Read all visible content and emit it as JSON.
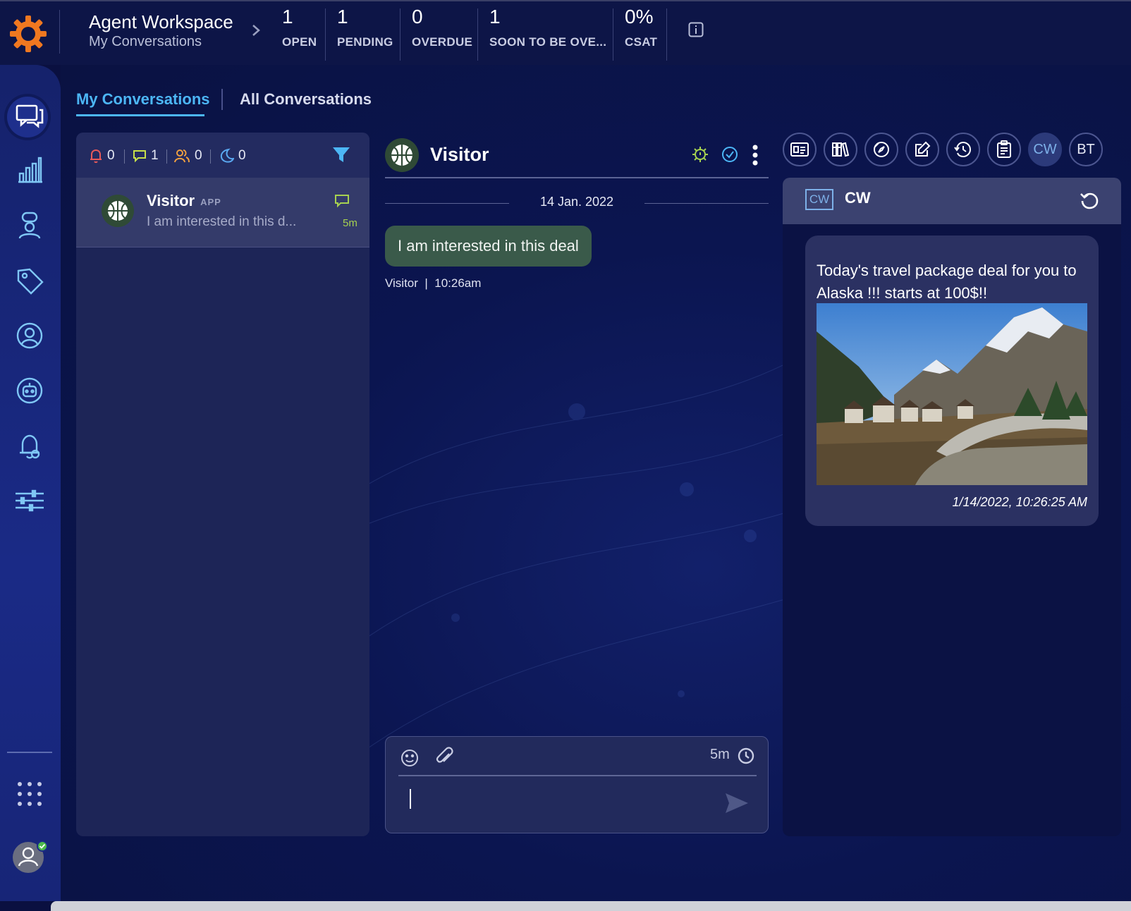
{
  "app": {
    "title": "Agent Workspace",
    "subtitle": "My Conversations"
  },
  "stats": [
    {
      "value": "1",
      "label": "OPEN"
    },
    {
      "value": "1",
      "label": "PENDING"
    },
    {
      "value": "0",
      "label": "OVERDUE"
    },
    {
      "value": "1",
      "label": "SOON TO BE OVE..."
    },
    {
      "value": "0%",
      "label": "CSAT"
    }
  ],
  "tabs": {
    "my": "My Conversations",
    "all": "All Conversations"
  },
  "filters": [
    {
      "icon": "bell-icon",
      "count": "0",
      "color": "#e85a5a"
    },
    {
      "icon": "chat-bubble-icon",
      "count": "1",
      "color": "#c8e04a"
    },
    {
      "icon": "users-icon",
      "count": "0",
      "color": "#f0a040"
    },
    {
      "icon": "moon-icon",
      "count": "0",
      "color": "#5aa8f0"
    }
  ],
  "list": {
    "items": [
      {
        "name": "Visitor",
        "badge": "APP",
        "preview": "I am interested in this d...",
        "time": "5m"
      }
    ]
  },
  "chat": {
    "visitor_name": "Visitor",
    "date": "14 Jan. 2022",
    "message": "I am interested in this deal",
    "meta": "Visitor  |  10:26am",
    "composer_timer": "5m"
  },
  "right": {
    "toolbar": [
      {
        "icon": "id-card-icon"
      },
      {
        "icon": "library-icon"
      },
      {
        "icon": "compass-icon"
      },
      {
        "icon": "edit-icon"
      },
      {
        "icon": "history-icon"
      },
      {
        "icon": "clipboard-icon"
      },
      {
        "label": "CW"
      },
      {
        "label": "BT"
      }
    ],
    "panel_badge": "CW",
    "panel_title": "CW",
    "card_text": "Today's travel package deal for you to Alaska !!! starts at 100$!!",
    "card_time": "1/14/2022, 10:26:25 AM"
  },
  "colors": {
    "accent": "#4cb6f5",
    "bubble": "#3a5a4a",
    "time_green": "#a6d150",
    "logo_orange": "#f07820"
  }
}
